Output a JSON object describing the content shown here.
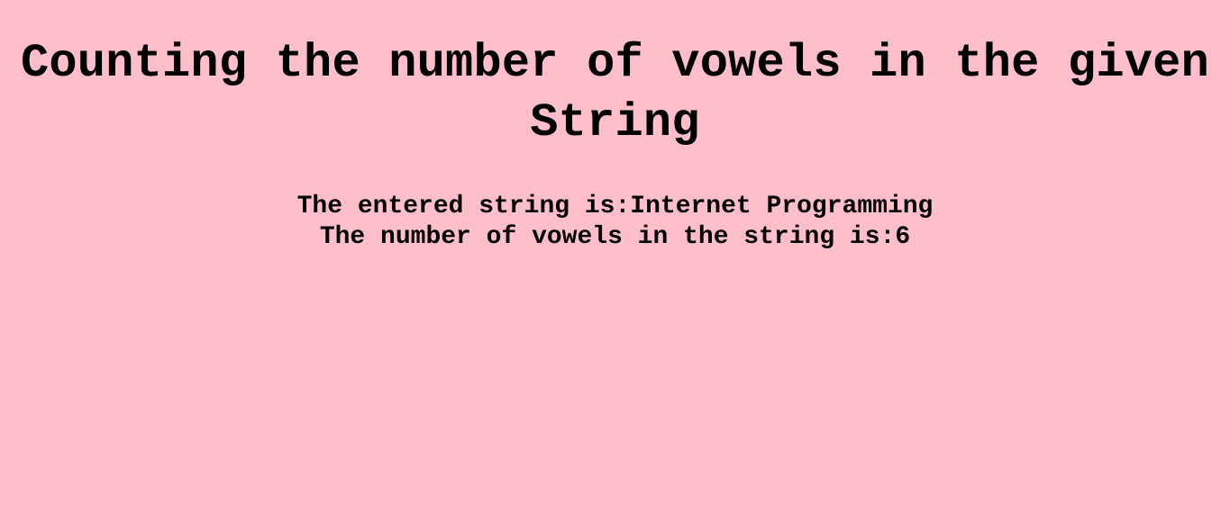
{
  "page": {
    "title": "Counting the number of vowels in the given String",
    "entered_string_label": "The entered string is:",
    "entered_string_value": "Internet Programming",
    "vowel_count_label": "The number of vowels in the string is:",
    "vowel_count_value": "6",
    "background_color": "#ffbfca",
    "text_color": "#000000"
  }
}
